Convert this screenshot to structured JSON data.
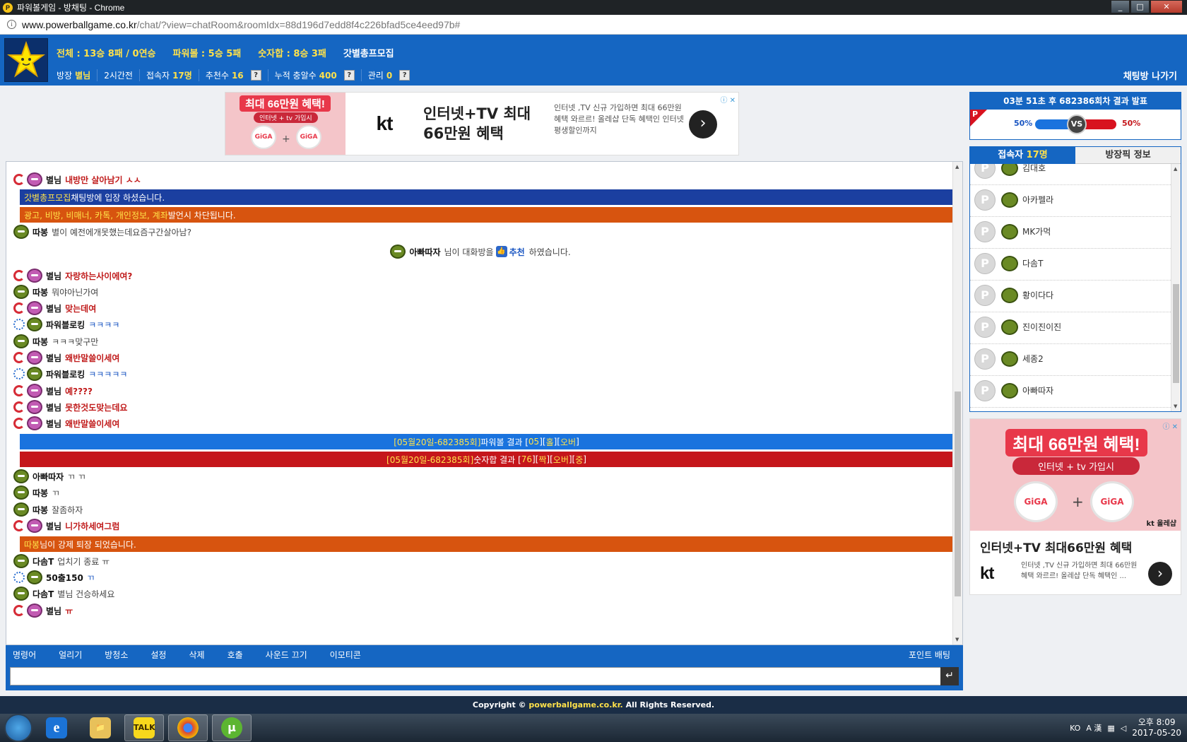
{
  "window": {
    "title": "파워볼게임 - 방채팅 - Chrome",
    "controls": [
      "_",
      "□",
      "✕"
    ]
  },
  "address": {
    "host": "www.powerballgame.co.kr",
    "path": "/chat/?view=chatRoom&roomIdx=88d196d7edd8f4c226bfad5ce4eed97b#"
  },
  "header": {
    "stats_total": "전체 : 13승 8패 / 0연승",
    "stats_powerball": "파워볼 : 5승 5패",
    "stats_number": "숫자합 : 8승 3패",
    "room_name": "갓별총프모집",
    "owner_label": "방장",
    "owner_value": "별님",
    "duration": "2시간전",
    "users_label": "접속자",
    "users_value": "17명",
    "recommend_label": "추천수",
    "recommend_value": "16",
    "points_label": "누적 충알수",
    "points_value": "400",
    "manage_label": "관리",
    "manage_value": "0",
    "help_glyph": "?",
    "exit_label": "채팅방 나가기"
  },
  "top_ad": {
    "promo_title": "최대 66만원 혜택!",
    "promo_sub": "인터넷 + tv 가입시",
    "giga_left": "GiGA",
    "giga_right": "GiGA",
    "plus": "+",
    "kt": "kt",
    "headline_1": "인터넷+TV 최대",
    "headline_2": "66만원 혜택",
    "body": "인터넷 ,TV 신규 가입하면 최대 66만원 혜택 와르르! 올레샵 단독 혜택인 인터넷 평생할인까지",
    "arrow": "›",
    "choices": "ⓘ ✕"
  },
  "chat": {
    "messages": [
      {
        "nick": "별님",
        "text": "내방만 살아남기 ㅅㅅ",
        "style": "red",
        "rank": "red",
        "face": "pink"
      },
      {
        "nick": "따봉",
        "text": "별이 예전에개못했는데요즘구간살아남?",
        "style": "",
        "rank": "none",
        "face": "green"
      },
      {
        "nick": "별님",
        "text": "자랑하는사이에여?",
        "style": "red",
        "rank": "red",
        "face": "pink"
      },
      {
        "nick": "따봉",
        "text": "뭐야아닌가여",
        "style": "",
        "rank": "none",
        "face": "green"
      },
      {
        "nick": "별님",
        "text": "맞는데여",
        "style": "red",
        "rank": "red",
        "face": "pink"
      },
      {
        "nick": "파워블로킹",
        "text": "ㅋㅋㅋㅋ",
        "style": "blue",
        "rank": "blue",
        "face": "green"
      },
      {
        "nick": "따봉",
        "text": "ㅋㅋㅋ맞구만",
        "style": "",
        "rank": "none",
        "face": "green"
      },
      {
        "nick": "별님",
        "text": "왜반말쓸이세여",
        "style": "red",
        "rank": "red",
        "face": "pink"
      },
      {
        "nick": "파워블로킹",
        "text": "ㅋㅋㅋㅋㅋ",
        "style": "blue",
        "rank": "blue",
        "face": "green"
      },
      {
        "nick": "별님",
        "text": "예????",
        "style": "red",
        "rank": "red",
        "face": "pink"
      },
      {
        "nick": "별님",
        "text": "못한것도맞는데요",
        "style": "red",
        "rank": "red",
        "face": "pink"
      },
      {
        "nick": "별님",
        "text": "왜반말쓸이세여",
        "style": "red",
        "rank": "red",
        "face": "pink"
      },
      {
        "nick": "아빠따자",
        "text": "ㄲ ㄲ",
        "style": "",
        "rank": "none",
        "face": "green"
      },
      {
        "nick": "따봉",
        "text": "ㄲ",
        "style": "",
        "rank": "none",
        "face": "green"
      },
      {
        "nick": "따봉",
        "text": "잘좀하자",
        "style": "",
        "rank": "none",
        "face": "green"
      },
      {
        "nick": "별님",
        "text": "니가하세여그럼",
        "style": "red",
        "rank": "red",
        "face": "pink"
      },
      {
        "nick": "다솜T",
        "text": "업치기 종료 ㅠ",
        "style": "",
        "rank": "none",
        "face": "green"
      },
      {
        "nick": "50출150",
        "text": "ㄲ",
        "style": "blue",
        "rank": "blue",
        "face": "green"
      },
      {
        "nick": "다솜T",
        "text": "별님 건승하세요",
        "style": "",
        "rank": "none",
        "face": "green"
      },
      {
        "nick": "별님",
        "text": "ㅠ",
        "style": "red",
        "rank": "red",
        "face": "pink"
      }
    ],
    "join_banner": {
      "who": "갓별총프모집",
      "rest": " 채팅방에 입장 하셨습니다."
    },
    "warning_banner": {
      "who": "광고, 비방, 비매너, 카톡, 개인정보, 계좌",
      "rest": " 발언시 차단됩니다."
    },
    "recommend": {
      "who": "아빠따자",
      "mid": " 님이 대화방을",
      "thumb": "👍",
      "link": "추천",
      "end": " 하였습니다."
    },
    "pb_result": {
      "round": "[05월20일-682385회]",
      "mid": " 파워볼 결과 [",
      "num": "05",
      "b1": "][",
      "t1": "홀",
      "b2": "][",
      "t2": "오버",
      "b3": "]"
    },
    "num_result": {
      "round": "[05월20일-682385회]",
      "mid": " 숫자합 결과 [",
      "num": "76",
      "b1": "][",
      "t1": "짝",
      "b2": "][",
      "t2": "오버",
      "b3": "][",
      "t3": "중",
      "b4": "]"
    },
    "kick_banner": {
      "who": "따봉",
      "rest": " 님이 강제 퇴장 되었습니다."
    },
    "scroll_up": "▲",
    "scroll_down": "▼"
  },
  "toolbar": {
    "items": [
      "명령어",
      "얼리기",
      "방청소",
      "설정",
      "삭제",
      "호출",
      "사운드 끄기",
      "이모티콘"
    ],
    "point_bet": "포인트 배팅",
    "send": "↵"
  },
  "result": {
    "header": "03분 51초 후 682386회차 결과 발표",
    "badge": "P",
    "left_pct": "50%",
    "right_pct": "50%",
    "vs": "VS",
    "left_share": 0.5
  },
  "users": {
    "tab_users_label": "접속자",
    "tab_users_count": "17명",
    "tab_info": "방장픽 정보",
    "p_glyph": "P",
    "list": [
      "김대호",
      "아카펠라",
      "MK가먹",
      "다솜T",
      "황이다다",
      "진이진이진",
      "세종2",
      "아빠따자"
    ],
    "scroll_up": "▲",
    "scroll_down": "▼"
  },
  "side_ad": {
    "promo_title": "최대 66만원 혜택!",
    "promo_sub": "인터넷 + tv 가입시",
    "giga_left": "GiGA",
    "giga_right": "GiGA",
    "plus": "+",
    "kt_small": "kt 올레샵",
    "headline": "인터넷+TV 최대66만원 혜택",
    "kt": "kt",
    "body": "인터넷 ,TV 신규 가입하면 최대 66만원 혜택 와르르! 올레샵 단독 혜택인 ...",
    "arrow": "›",
    "choices": "ⓘ ✕"
  },
  "footer": {
    "prefix": "Copyright © ",
    "site": "powerballgame.co.kr.",
    "suffix": " All Rights Reserved."
  },
  "taskbar": {
    "apps": [
      "e",
      "📁",
      "TALK",
      "⬤",
      "μ"
    ],
    "tray_lang": "KO",
    "tray_ime": "A 漢",
    "time": "오후 8:09",
    "date": "2017-05-20"
  }
}
